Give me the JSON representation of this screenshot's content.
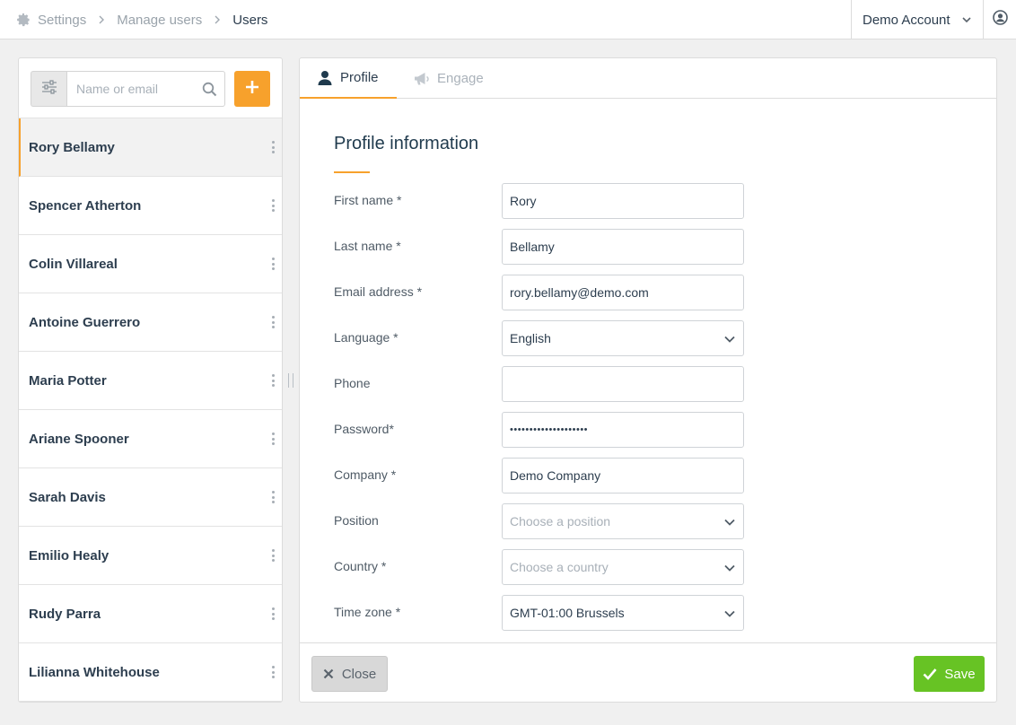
{
  "breadcrumb": {
    "settings": "Settings",
    "manage_users": "Manage users",
    "users": "Users"
  },
  "account": {
    "name": "Demo Account"
  },
  "search": {
    "placeholder": "Name or email"
  },
  "users": [
    "Rory Bellamy",
    "Spencer Atherton",
    "Colin Villareal",
    "Antoine Guerrero",
    "Maria Potter",
    "Ariane Spooner",
    "Sarah Davis",
    "Emilio Healy",
    "Rudy Parra",
    "Lilianna Whitehouse"
  ],
  "tabs": {
    "profile": "Profile",
    "engage": "Engage"
  },
  "profile": {
    "title": "Profile information",
    "first_name_label": "First name *",
    "first_name_value": "Rory",
    "last_name_label": "Last name *",
    "last_name_value": "Bellamy",
    "email_label": "Email address *",
    "email_value": "rory.bellamy@demo.com",
    "language_label": "Language *",
    "language_value": "English",
    "phone_label": "Phone",
    "phone_value": "",
    "password_label": "Password*",
    "password_value": "••••••••••••••••••••",
    "company_label": "Company *",
    "company_value": "Demo Company",
    "position_label": "Position",
    "position_placeholder": "Choose a position",
    "country_label": "Country *",
    "country_placeholder": "Choose a country",
    "timezone_label": "Time zone *",
    "timezone_value": "GMT-01:00 Brussels"
  },
  "footer": {
    "close_label": "Close",
    "save_label": "Save"
  },
  "colors": {
    "accent": "#f7a12c",
    "save": "#67c324",
    "text_dark": "#2d3e4f",
    "muted": "#9aa3ab"
  },
  "icons": [
    "gear-icon",
    "chevron-right-icon",
    "chevron-down-icon",
    "user-circle-icon",
    "sliders-icon",
    "search-icon",
    "plus-icon",
    "kebab-icon",
    "user-icon",
    "megaphone-icon",
    "close-icon",
    "check-icon"
  ]
}
